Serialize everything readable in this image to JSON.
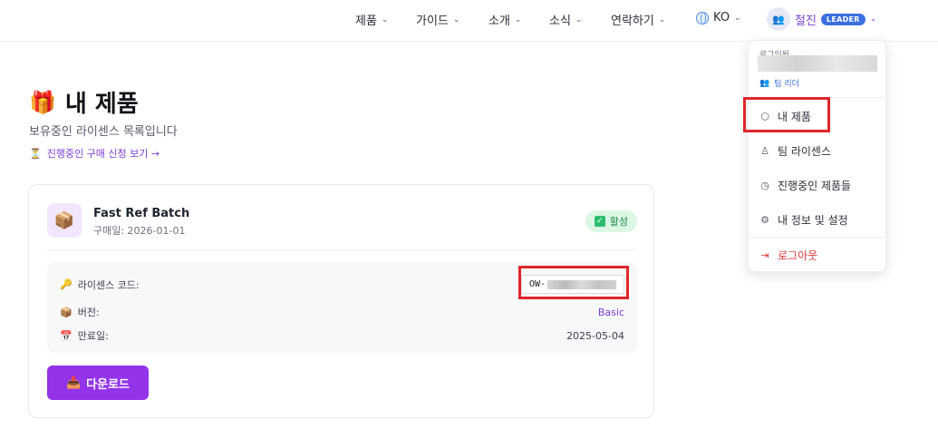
{
  "nav": {
    "items": [
      {
        "label": "제품"
      },
      {
        "label": "가이드"
      },
      {
        "label": "소개"
      },
      {
        "label": "소식"
      },
      {
        "label": "연락하기"
      }
    ],
    "language": "KO",
    "user_name": "철진",
    "user_badge": "LEADER"
  },
  "header": {
    "title": "내 제품",
    "subtitle": "보유중인 라이센스 목록입니다",
    "pending_link": "진행중인 구매 신청 보기 →"
  },
  "product": {
    "name": "Fast Ref Batch",
    "purchase_date": "구매일: 2026-01-01",
    "status": "활성",
    "license_label": "라이센스 코드:",
    "license_prefix": "OW-",
    "version_label": "버전:",
    "version_value": "Basic",
    "expiry_label": "만료일:",
    "expiry_value": "2025-05-04",
    "download_label": "다운로드"
  },
  "menu": {
    "header_label": "로그인됨",
    "role": "팀 리더",
    "items": [
      {
        "label": "내 제품",
        "icon": "cube-icon"
      },
      {
        "label": "팀 라이센스",
        "icon": "team-icon"
      },
      {
        "label": "진행중인 제품들",
        "icon": "clock-icon"
      },
      {
        "label": "내 정보 및 설정",
        "icon": "gear-icon"
      }
    ],
    "logout": "로그아웃"
  },
  "colors": {
    "accent": "#9333ea",
    "user_name": "#7b3fd6",
    "badge": "#3b6fe0",
    "active": "#1f8a4c",
    "highlight": "#e0262b",
    "logout": "#e03a3a"
  }
}
